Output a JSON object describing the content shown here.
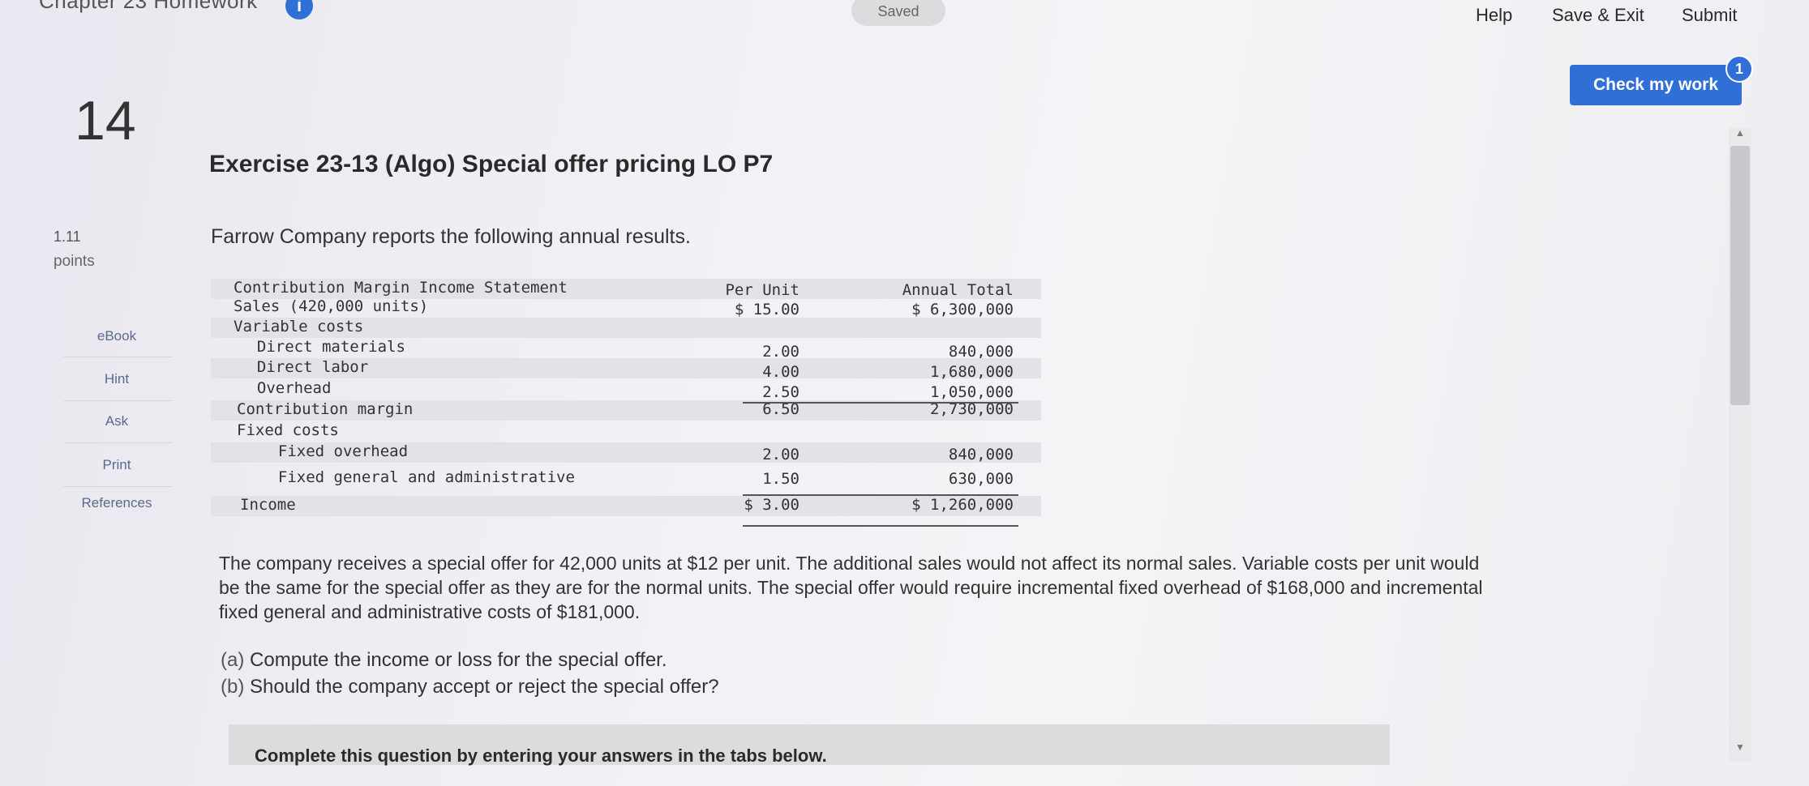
{
  "header": {
    "chapter_title": "Chapter 23 Homework",
    "chapter_info_badge": "i",
    "saved_label": "Saved",
    "help_label": "Help",
    "save_exit_label": "Save & Exit",
    "submit_label": "Submit",
    "check_work_label": "Check my work",
    "check_work_badge": "1"
  },
  "sidebar": {
    "question_number": "14",
    "points_value": "1.11",
    "points_label": "points",
    "links": [
      "eBook",
      "Hint",
      "Ask",
      "Print",
      "References"
    ]
  },
  "exercise": {
    "title": "Exercise 23-13 (Algo) Special offer pricing LO P7",
    "intro": "Farrow Company reports the following annual results."
  },
  "statement": {
    "title": "Contribution Margin Income Statement",
    "col_per_unit": "Per Unit",
    "col_annual_total": "Annual Total",
    "rows": [
      {
        "label": "Sales (420,000 units)",
        "per_unit": "$ 15.00",
        "annual_total": "$ 6,300,000"
      },
      {
        "label": "Variable costs",
        "per_unit": "",
        "annual_total": ""
      },
      {
        "label": "  Direct materials",
        "per_unit": "2.00",
        "annual_total": "840,000"
      },
      {
        "label": "  Direct labor",
        "per_unit": "4.00",
        "annual_total": "1,680,000"
      },
      {
        "label": "  Overhead",
        "per_unit": "2.50",
        "annual_total": "1,050,000"
      },
      {
        "label": "Contribution margin",
        "per_unit": "6.50",
        "annual_total": "2,730,000"
      },
      {
        "label": "Fixed costs",
        "per_unit": "",
        "annual_total": ""
      },
      {
        "label": "  Fixed overhead",
        "per_unit": "2.00",
        "annual_total": "840,000"
      },
      {
        "label": "  Fixed general and administrative",
        "per_unit": "1.50",
        "annual_total": "630,000"
      },
      {
        "label": "Income",
        "per_unit": "$ 3.00",
        "annual_total": "$ 1,260,000"
      }
    ]
  },
  "problem": {
    "paragraph": "The company receives a special offer for 42,000 units at $12 per unit. The additional sales would not affect its normal sales. Variable costs per unit would be the same for the special offer as they are for the normal units. The special offer would require incremental fixed overhead of $168,000 and incremental fixed general and administrative costs of $181,000.",
    "part_a_tag": "(a)",
    "part_a": "Compute the income or loss for the special offer.",
    "part_b_tag": "(b)",
    "part_b": "Should the company accept or reject the special offer?",
    "complete_prompt": "Complete this question by entering your answers in the tabs below."
  }
}
